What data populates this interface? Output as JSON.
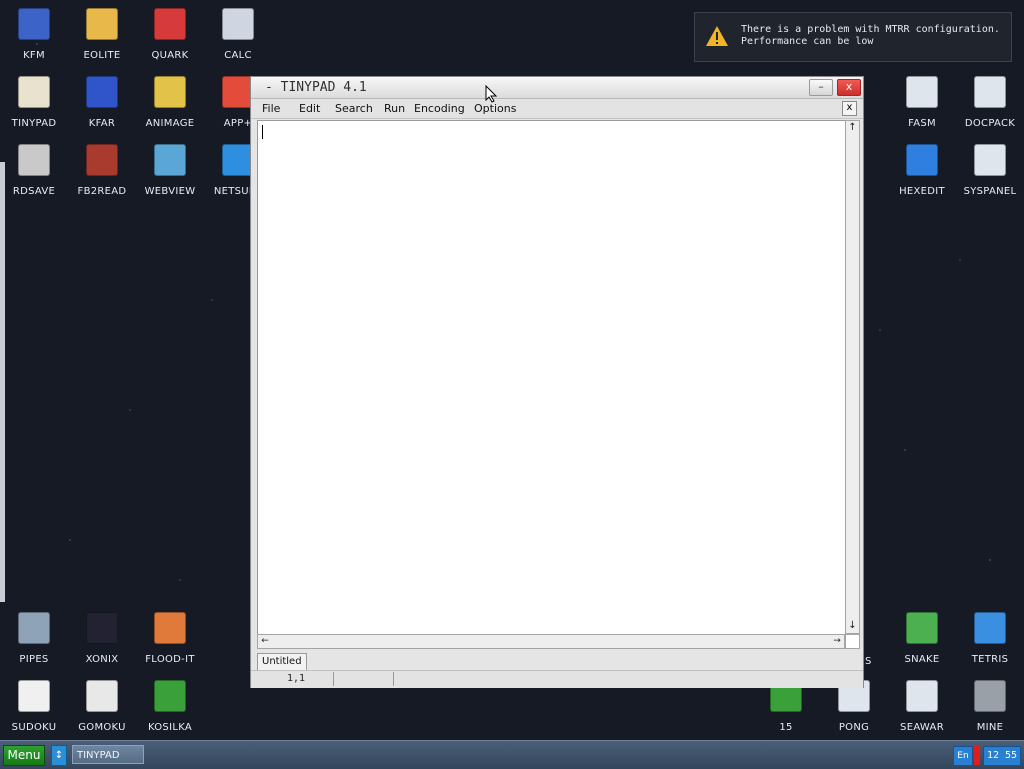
{
  "desktop": {
    "icons_left": [
      {
        "label": "KFM",
        "icon": "floppy-disk-icon",
        "color": "#3b63c8"
      },
      {
        "label": "EOLITE",
        "icon": "folder-icon",
        "color": "#e8b84a"
      },
      {
        "label": "QUARK",
        "icon": "book-icon",
        "color": "#d73a3a"
      },
      {
        "label": "CALC",
        "icon": "calculator-icon",
        "color": "#cfd6e2"
      },
      {
        "label": "TINYPAD",
        "icon": "notepad-icon",
        "color": "#e8e2cf"
      },
      {
        "label": "KFAR",
        "icon": "file-manager-icon",
        "color": "#2f55c9"
      },
      {
        "label": "ANIMAGE",
        "icon": "pencil-icon",
        "color": "#e3c24a"
      },
      {
        "label": "APP+",
        "icon": "rubik-cube-icon",
        "color": "#e34b3a"
      },
      {
        "label": "RDSAVE",
        "icon": "save-disk-icon",
        "color": "#c9c9c9"
      },
      {
        "label": "FB2READ",
        "icon": "ebook-icon",
        "color": "#a83a2e"
      },
      {
        "label": "WEBVIEW",
        "icon": "picture-icon",
        "color": "#5aa6d6"
      },
      {
        "label": "NETSURF",
        "icon": "globe-icon",
        "color": "#2e8fe0"
      }
    ],
    "icons_right": [
      {
        "label": "FASM",
        "icon": "tools-icon",
        "color": "#dfe5ec"
      },
      {
        "label": "DOCPACK",
        "icon": "cabinet-icon",
        "color": "#dfe5ec"
      },
      {
        "label": "HEXEDIT",
        "icon": "hex-editor-icon",
        "color": "#2e7fe0"
      },
      {
        "label": "SYSPANEL",
        "icon": "control-panel-icon",
        "color": "#dfe5ec"
      }
    ],
    "icons_bottom_left": [
      {
        "label": "PIPES",
        "icon": "pipes-icon",
        "color": "#8ea3b8"
      },
      {
        "label": "XONIX",
        "icon": "xonix-icon",
        "color": "#222233"
      },
      {
        "label": "FLOOD-IT",
        "icon": "flood-it-icon",
        "color": "#e07a3a"
      },
      {
        "label": "SUDOKU",
        "icon": "sudoku-icon",
        "color": "#f0f0f0"
      },
      {
        "label": "GOMOKU",
        "icon": "gomoku-icon",
        "color": "#e8e8e8"
      },
      {
        "label": "KOSILKA",
        "icon": "lawnmower-icon",
        "color": "#3aa03a"
      }
    ],
    "icons_bottom_right": [
      {
        "label": "SNAKE",
        "icon": "snake-icon",
        "color": "#4caf50"
      },
      {
        "label": "TETRIS",
        "icon": "tetris-icon",
        "color": "#3a8fe0"
      },
      {
        "label": "15",
        "icon": "fifteen-puzzle-icon",
        "color": "#3aa03a"
      },
      {
        "label": "PONG",
        "icon": "pong-icon",
        "color": "#dfe5ec"
      },
      {
        "label": "SEAWAR",
        "icon": "seawar-icon",
        "color": "#dfe5ec"
      },
      {
        "label": "MINE",
        "icon": "mine-icon",
        "color": "#9aa0a8"
      }
    ],
    "partial_label": "S"
  },
  "notification": {
    "line1": "There is a problem with MTRR configuration.",
    "line2": "Performance can be low",
    "icon": "warning-icon",
    "icon_color": "#f0b429"
  },
  "window": {
    "title": "- TINYPAD 4.1",
    "minimize_label": "–",
    "close_label": "x",
    "menu": [
      "File",
      "Edit",
      "Search",
      "Run",
      "Encoding",
      "Options"
    ],
    "menu_close_label": "x",
    "scroll_up": "↑",
    "scroll_down": "↓",
    "scroll_left": "←",
    "scroll_right": "→",
    "tab": "Untitled",
    "status_position": "1,1"
  },
  "taskbar": {
    "menu_label": "Menu",
    "swap_label": "↕",
    "task_label": "TINYPAD",
    "language": "En",
    "clock": "12 55"
  }
}
